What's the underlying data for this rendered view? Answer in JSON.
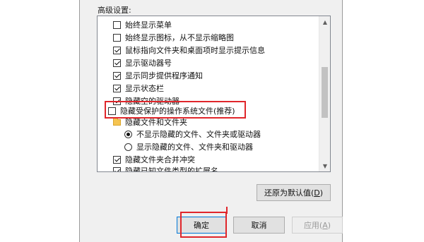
{
  "section_label": "高级设置:",
  "items": [
    {
      "type": "checkbox",
      "checked": false,
      "label": "始终显示菜单"
    },
    {
      "type": "checkbox",
      "checked": false,
      "label": "始终显示图标，从不显示缩略图"
    },
    {
      "type": "checkbox",
      "checked": true,
      "label": "鼠标指向文件夹和桌面项时显示提示信息"
    },
    {
      "type": "checkbox",
      "checked": true,
      "label": "显示驱动器号"
    },
    {
      "type": "checkbox",
      "checked": true,
      "label": "显示同步提供程序通知"
    },
    {
      "type": "checkbox",
      "checked": true,
      "label": "显示状态栏"
    },
    {
      "type": "checkbox",
      "checked": true,
      "label": "隐藏空的驱动器"
    },
    {
      "type": "checkbox",
      "checked": false,
      "label": "隐藏受保护的操作系统文件(推荐)"
    },
    {
      "type": "folder",
      "label": "隐藏文件和文件夹"
    },
    {
      "type": "radio",
      "checked": true,
      "label": "不显示隐藏的文件、文件夹或驱动器"
    },
    {
      "type": "radio",
      "checked": false,
      "label": "显示隐藏的文件、文件夹和驱动器"
    },
    {
      "type": "checkbox",
      "checked": true,
      "label": "隐藏文件夹合并冲突"
    },
    {
      "type": "checkbox",
      "checked": true,
      "label": "隐藏已知文件类型的扩展名"
    }
  ],
  "restore_button": {
    "label": "还原为默认值(",
    "key": "D",
    "suffix": ")"
  },
  "ok_button": "确定",
  "cancel_button": "取消",
  "apply_button": {
    "label": "应用(",
    "key": "A",
    "suffix": ")"
  },
  "colors": {
    "highlight": "#e0262b"
  },
  "icons": {
    "scroll_up": "scroll-up-arrow-icon",
    "scroll_down": "scroll-down-arrow-icon"
  }
}
